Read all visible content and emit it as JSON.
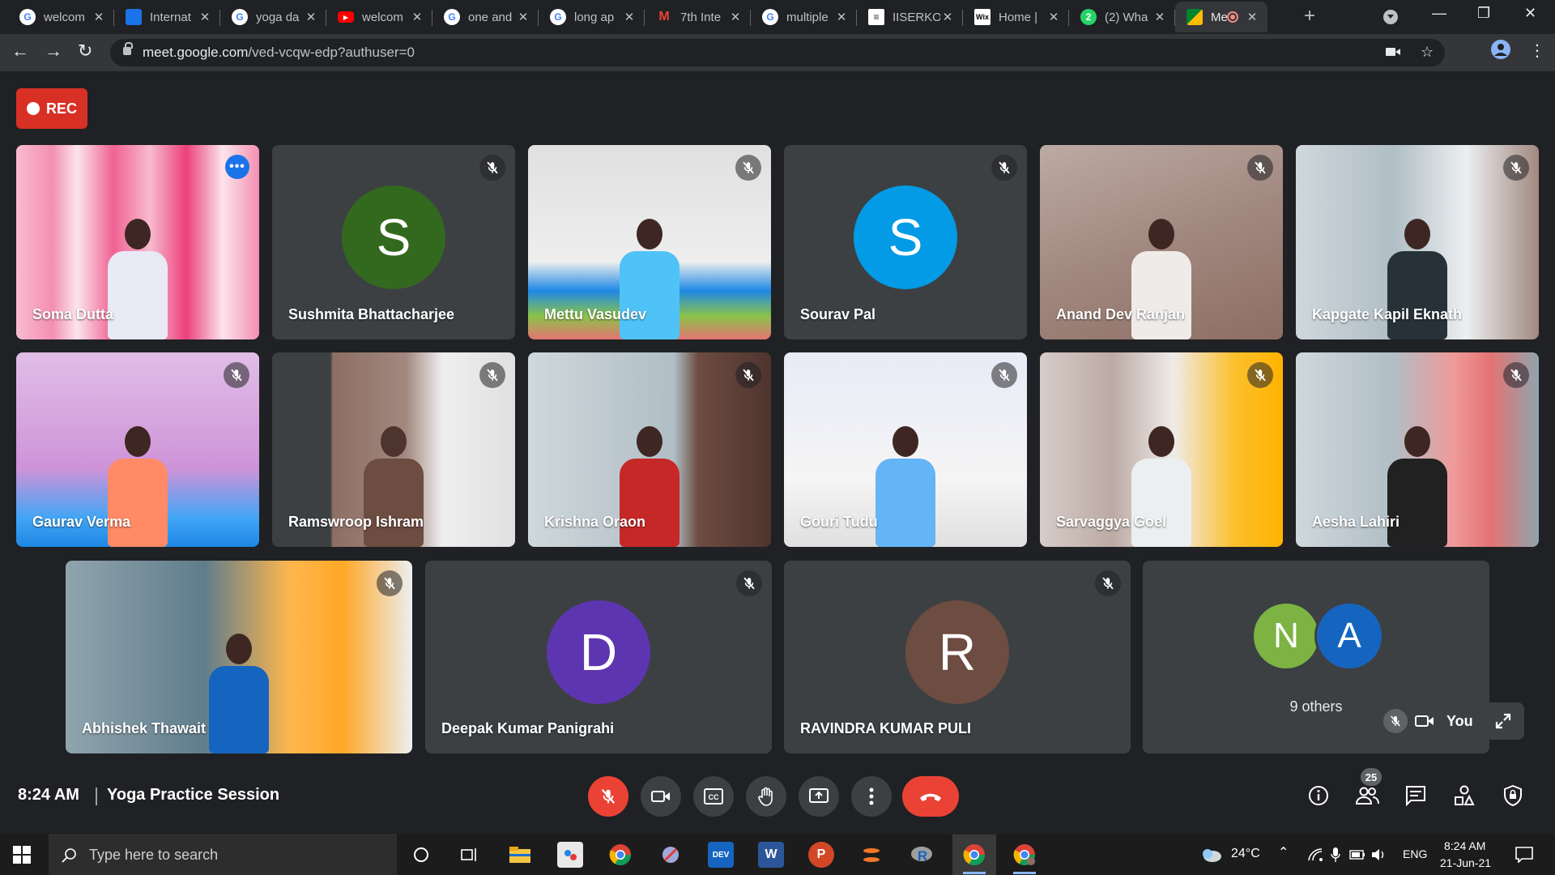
{
  "browser": {
    "tabs": [
      {
        "title": "welcom",
        "favicon": "google-icon",
        "fav_color": "#4285f4"
      },
      {
        "title": "Internat",
        "favicon": "site-icon",
        "fav_color": "#1a73e8"
      },
      {
        "title": "yoga da",
        "favicon": "google-icon",
        "fav_color": "#4285f4"
      },
      {
        "title": "welcom",
        "favicon": "youtube-icon",
        "fav_color": "#ff0000"
      },
      {
        "title": "one and",
        "favicon": "google-icon",
        "fav_color": "#4285f4"
      },
      {
        "title": "long ap",
        "favicon": "google-icon",
        "fav_color": "#4285f4"
      },
      {
        "title": "7th Inte",
        "favicon": "gmail-icon",
        "fav_color": "#ea4335"
      },
      {
        "title": "multiple",
        "favicon": "google-icon",
        "fav_color": "#4285f4"
      },
      {
        "title": "IISERKO",
        "favicon": "iiser-icon",
        "fav_color": "#ffffff"
      },
      {
        "title": "Home |",
        "favicon": "wix-icon",
        "fav_color": "#ffffff"
      },
      {
        "title": "(2) Wha",
        "favicon": "whatsapp-icon",
        "fav_color": "#25d366"
      },
      {
        "title": "Me",
        "favicon": "meet-icon",
        "fav_color": "#00832d",
        "active": true
      }
    ],
    "url_host": "meet.google.com",
    "url_path": "/ved-vcqw-edp?authuser=0"
  },
  "meet": {
    "rec_label": "REC",
    "participants_row1": [
      {
        "name": "Soma Dutta",
        "type": "video",
        "selected": true
      },
      {
        "name": "Sushmita Bhattacharjee",
        "type": "avatar",
        "initial": "S",
        "avatar_color": "#33691e"
      },
      {
        "name": "Mettu Vasudev",
        "type": "video"
      },
      {
        "name": "Sourav Pal",
        "type": "avatar",
        "initial": "S",
        "avatar_color": "#039be5"
      },
      {
        "name": "Anand Dev Ranjan",
        "type": "video"
      },
      {
        "name": "Kapgate Kapil Eknath",
        "type": "video"
      }
    ],
    "participants_row2": [
      {
        "name": "Gaurav Verma",
        "type": "video"
      },
      {
        "name": "Ramswroop Ishram",
        "type": "video"
      },
      {
        "name": "Krishna Oraon",
        "type": "video"
      },
      {
        "name": "Gouri Tudu",
        "type": "video"
      },
      {
        "name": "Sarvaggya Goel",
        "type": "video"
      },
      {
        "name": "Aesha Lahiri",
        "type": "video"
      }
    ],
    "participants_row3": [
      {
        "name": "Abhishek Thawait",
        "type": "video"
      },
      {
        "name": "Deepak Kumar Panigrahi",
        "type": "avatar",
        "initial": "D",
        "avatar_color": "#5e35b1"
      },
      {
        "name": "RAVINDRA KUMAR PULI",
        "type": "avatar",
        "initial": "R",
        "avatar_color": "#6d4c41"
      }
    ],
    "others": {
      "initials": [
        "N",
        "A"
      ],
      "colors": [
        "#7cb342",
        "#1565c0"
      ],
      "label": "9 others"
    },
    "self_label": "You",
    "time": "8:24 AM",
    "meeting_title": "Yoga Practice Session",
    "people_count": "25"
  },
  "taskbar": {
    "search_placeholder": "Type here to search",
    "weather": "24°C",
    "language": "ENG",
    "clock_time": "8:24 AM",
    "clock_date": "21-Jun-21"
  }
}
